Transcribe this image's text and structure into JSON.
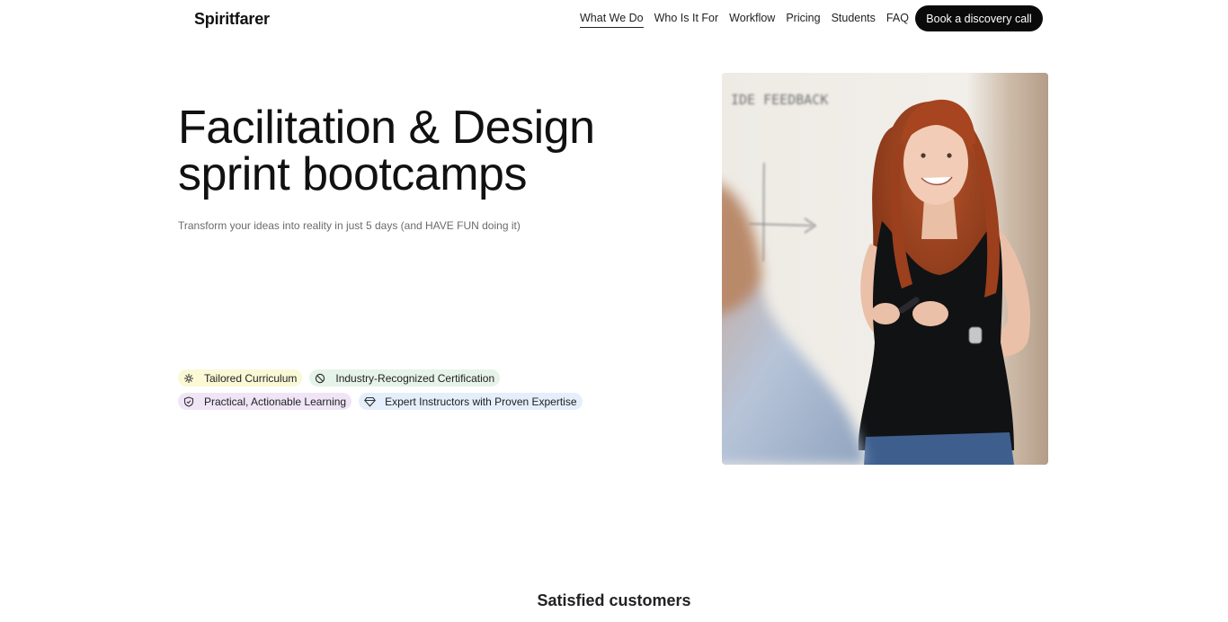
{
  "header": {
    "brand": "Spiritfarer",
    "nav": [
      {
        "label": "What We Do",
        "active": true
      },
      {
        "label": "Who Is It For",
        "active": false
      },
      {
        "label": "Workflow",
        "active": false
      },
      {
        "label": "Pricing",
        "active": false
      },
      {
        "label": "Students",
        "active": false
      },
      {
        "label": "FAQ",
        "active": false
      }
    ],
    "cta_label": "Book a discovery call"
  },
  "hero": {
    "title_line1": "Facilitation & Design",
    "title_line2": "sprint bootcamps",
    "subtitle": "Transform your ideas into reality in just 5 days (and HAVE FUN doing it)",
    "whiteboard_text": "IDE FEEDBACK",
    "chips": [
      {
        "label": "Tailored Curriculum",
        "icon": "settings-icon",
        "color": "#fbf8d6"
      },
      {
        "label": "Industry-Recognized Certification",
        "icon": "badge-icon",
        "color": "#e6f3e8"
      },
      {
        "label": "Practical, Actionable Learning",
        "icon": "shield-icon",
        "color": "#efe5f6"
      },
      {
        "label": "Expert Instructors with Proven Expertise",
        "icon": "diamond-icon",
        "color": "#e5eefb"
      }
    ]
  },
  "section": {
    "satisfied_heading": "Satisfied customers"
  }
}
